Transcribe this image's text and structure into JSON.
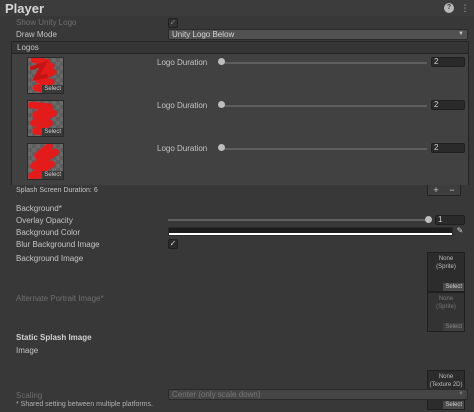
{
  "header": {
    "title": "Player",
    "help_icon": "?",
    "menu_icon": "⋮"
  },
  "splash": {
    "show_unity_logo_label": "Show Unity Logo",
    "show_unity_logo_check": "✓",
    "draw_mode_label": "Draw Mode",
    "draw_mode_value": "Unity Logo Below"
  },
  "logos": {
    "title": "Logos",
    "items": [
      {
        "duration_label": "Logo Duration",
        "duration_value": "2",
        "select_label": "Select"
      },
      {
        "duration_label": "Logo Duration",
        "duration_value": "2",
        "select_label": "Select"
      },
      {
        "duration_label": "Logo Duration",
        "duration_value": "2",
        "select_label": "Select"
      }
    ]
  },
  "splash_duration": "Splash Screen Duration: 6",
  "list_controls": {
    "add": "+",
    "remove": "−"
  },
  "background": {
    "section_label": "Background*",
    "overlay_opacity_label": "Overlay Opacity",
    "overlay_opacity_value": "1",
    "overlay_opacity_fraction": 1,
    "background_color_label": "Background Color",
    "background_color_value": "#1c1c1c",
    "blur_label": "Blur Background Image",
    "blur_check": "✓",
    "background_image_label": "Background Image",
    "background_image_none": "None",
    "background_image_type": "(Sprite)",
    "background_image_select": "Select",
    "alt_portrait_label": "Alternate Portrait Image*",
    "alt_portrait_none": "None",
    "alt_portrait_type": "(Sprite)",
    "alt_portrait_select": "Select"
  },
  "static_splash": {
    "section_label": "Static Splash Image",
    "image_label": "Image",
    "image_none": "None",
    "image_type": "(Texture 2D)",
    "image_select": "Select",
    "scaling_label": "Scaling",
    "scaling_value": "Center (only scale down)"
  },
  "footnote": "* Shared setting between multiple platforms.",
  "colors": {
    "accent_logo_scribble": "#e31b1b",
    "panel_bg": "#383838"
  }
}
